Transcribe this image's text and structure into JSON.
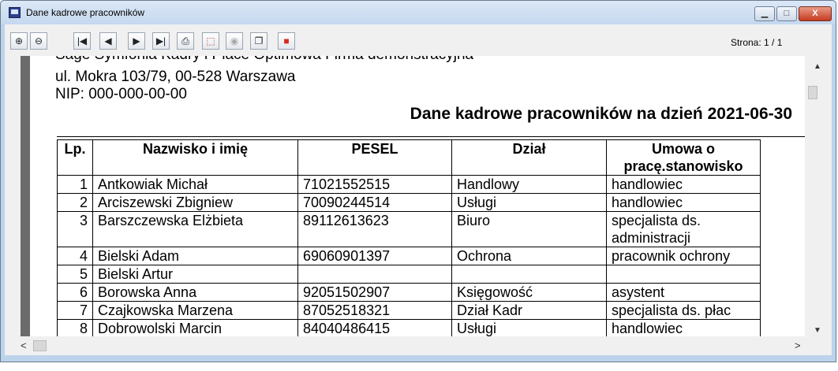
{
  "window": {
    "title": "Dane kadrowe pracowników",
    "min_label": "▁",
    "max_label": "□",
    "close_label": "X"
  },
  "toolbar": {
    "zoom_in": "⊕",
    "zoom_out": "⊖",
    "first": "|◀",
    "prev": "◀",
    "next": "▶",
    "last": "▶|",
    "print": "⎙",
    "pdf": "⬚",
    "mail": "◉",
    "copy": "❐",
    "close": "■",
    "page_indicator": "Strona: 1 / 1"
  },
  "report": {
    "company_line": "Sage Symfonia Kadry i Płace Optimowa Firma demonstracyjna",
    "address_line": "ul. Mokra 103/79, 00-528 Warszawa",
    "nip_line": "NIP: 000-000-00-00",
    "title": "Dane kadrowe pracowników na dzień 2021-06-30",
    "columns": {
      "lp": "Lp.",
      "name": "Nazwisko i imię",
      "pesel": "PESEL",
      "dept": "Dział",
      "role": "Umowa o pracę.stanowisko"
    },
    "rows": [
      {
        "lp": "1",
        "name": "Antkowiak Michał",
        "pesel": "71021552515",
        "dept": "Handlowy",
        "role": "handlowiec"
      },
      {
        "lp": "2",
        "name": "Arciszewski Zbigniew",
        "pesel": "70090244514",
        "dept": "Usługi",
        "role": "handlowiec"
      },
      {
        "lp": "3",
        "name": "Barszczewska Elżbieta",
        "pesel": "89112613623",
        "dept": "Biuro",
        "role": "specjalista ds. administracji"
      },
      {
        "lp": "4",
        "name": "Bielski Adam",
        "pesel": "69060901397",
        "dept": "Ochrona",
        "role": "pracownik ochrony"
      },
      {
        "lp": "5",
        "name": "Bielski Artur",
        "pesel": "",
        "dept": "",
        "role": ""
      },
      {
        "lp": "6",
        "name": "Borowska Anna",
        "pesel": "92051502907",
        "dept": "Księgowość",
        "role": "asystent"
      },
      {
        "lp": "7",
        "name": "Czajkowska Marzena",
        "pesel": "87052518321",
        "dept": "Dział Kadr",
        "role": "specjalista ds. płac"
      },
      {
        "lp": "8",
        "name": "Dobrowolski Marcin",
        "pesel": "84040486415",
        "dept": "Usługi",
        "role": "handlowiec"
      }
    ]
  },
  "scroll": {
    "up": "▲",
    "down": "▼",
    "left": "<",
    "right": ">"
  }
}
